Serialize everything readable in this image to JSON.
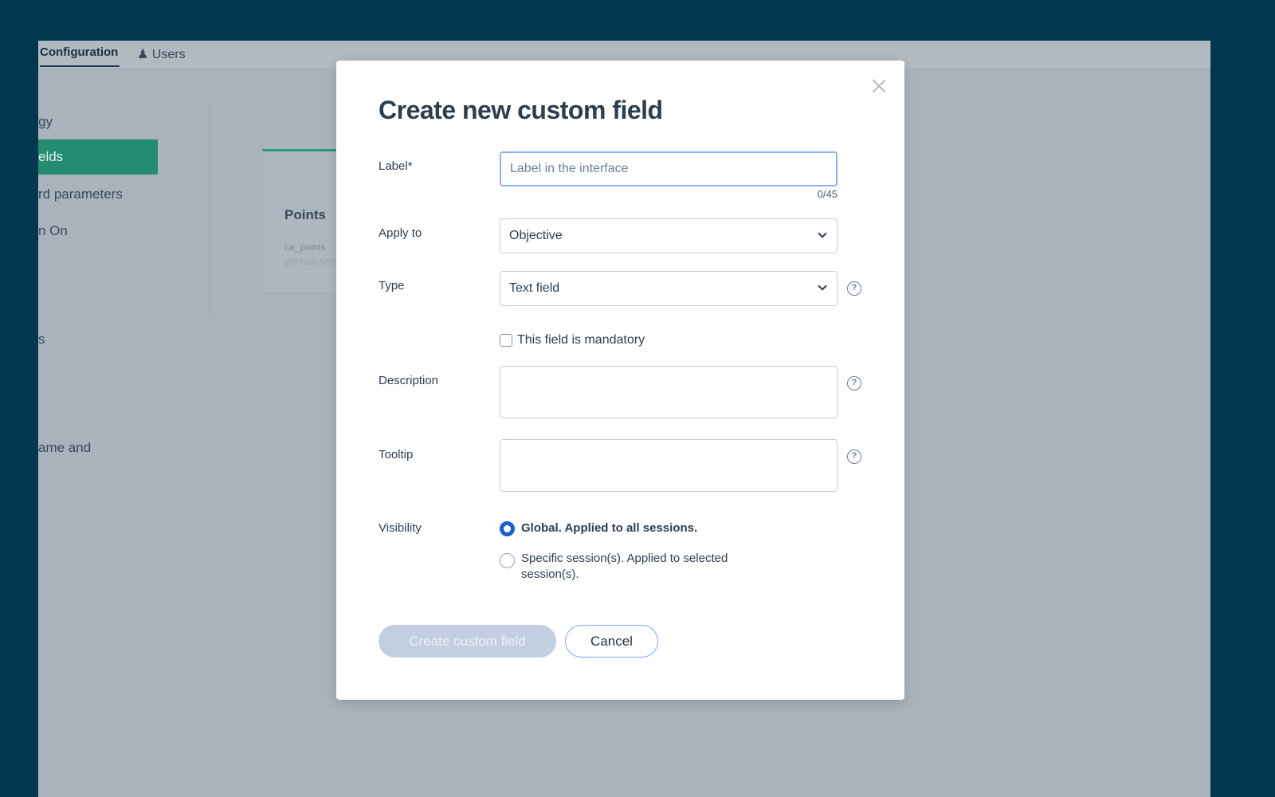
{
  "background_app": {
    "tabs": [
      {
        "label": "Configuration",
        "active": true
      },
      {
        "label": "Users",
        "icon": "users-icon"
      }
    ],
    "sidebar": [
      {
        "label": "gy"
      },
      {
        "label": "elds",
        "active": true
      },
      {
        "label": "rd parameters"
      },
      {
        "label": "n On"
      },
      {
        "label": "s"
      },
      {
        "label": "ame and"
      }
    ],
    "card": {
      "title": "Points",
      "key": "ca_points",
      "sub": "gtmhub.sele"
    }
  },
  "modal": {
    "title": "Create new custom field",
    "label_field": {
      "label": "Label*",
      "value": "",
      "placeholder": "Label in the interface",
      "counter": "0/45"
    },
    "apply_to": {
      "label": "Apply to",
      "value": "Objective"
    },
    "type": {
      "label": "Type",
      "value": "Text field"
    },
    "mandatory": {
      "label": "This field is mandatory",
      "checked": false
    },
    "description": {
      "label": "Description",
      "value": ""
    },
    "tooltip": {
      "label": "Tooltip",
      "value": ""
    },
    "visibility": {
      "label": "Visibility",
      "options": [
        {
          "label": "Global. Applied to all sessions.",
          "selected": true
        },
        {
          "label": "Specific session(s). Applied to selected session(s).",
          "selected": false
        }
      ]
    },
    "create_button": "Create custom field",
    "cancel_button": "Cancel",
    "colors": {
      "accent": "#1a5fd0",
      "disabled_button": "#c3cfe0",
      "active_nav": "#238c71"
    }
  }
}
